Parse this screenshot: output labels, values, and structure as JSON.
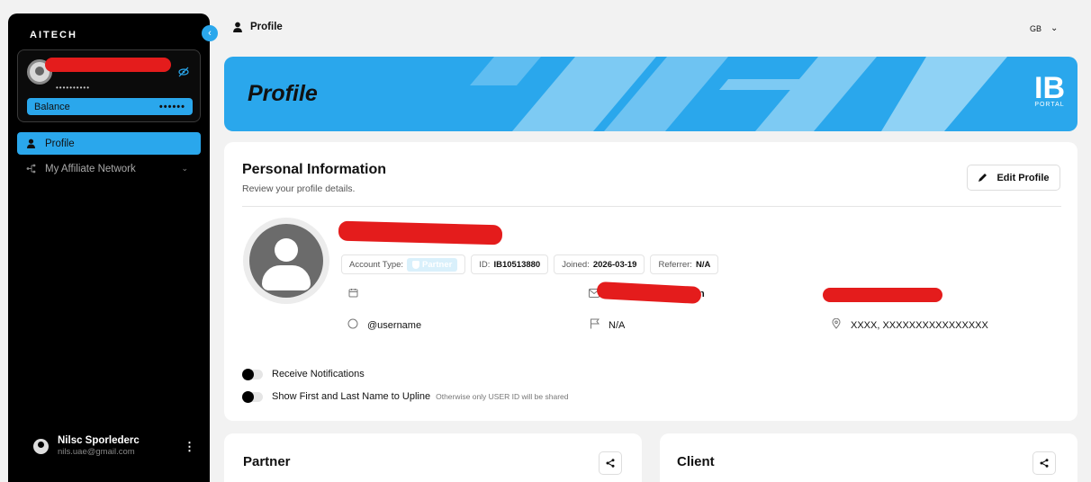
{
  "sidebar": {
    "logo": "AITECH",
    "user_masked": "••••••••••",
    "balance_label": "Balance",
    "balance_value": "••••••",
    "nav": [
      {
        "label": "Profile",
        "icon": "user-icon"
      },
      {
        "label": "My Affiliate Network",
        "icon": "network-icon"
      }
    ],
    "footer": {
      "name": "Nilsc Sporlederc",
      "email": "nils.uae@gmail.com"
    }
  },
  "header": {
    "title": "Profile",
    "language": "GB"
  },
  "banner": {
    "title": "Profile",
    "logo_mark": "IB",
    "logo_text": "PORTAL"
  },
  "personal": {
    "title": "Personal Information",
    "subtitle": "Review your profile details.",
    "edit_label": "Edit Profile",
    "account_type_label": "Account Type:",
    "account_type_value": "Partner",
    "id_label": "ID:",
    "id_value": "IB10513880",
    "joined_label": "Joined:",
    "joined_value": "2026-03-19",
    "referrer_label": "Referrer:",
    "referrer_value": "N/A",
    "email_tail": "n",
    "username": "@username",
    "country": "N/A",
    "address": "XXXX, XXXXXXXXXXXXXXXX",
    "toggles": [
      {
        "label": "Receive Notifications",
        "note": ""
      },
      {
        "label": "Show First and Last Name to Upline",
        "note": "Otherwise only USER ID will be shared"
      }
    ]
  },
  "bottom_cards": [
    {
      "title": "Partner"
    },
    {
      "title": "Client"
    }
  ],
  "colors": {
    "accent": "#2aa7ec",
    "sidebar_bg": "#000000",
    "redaction": "#e41c1c"
  }
}
